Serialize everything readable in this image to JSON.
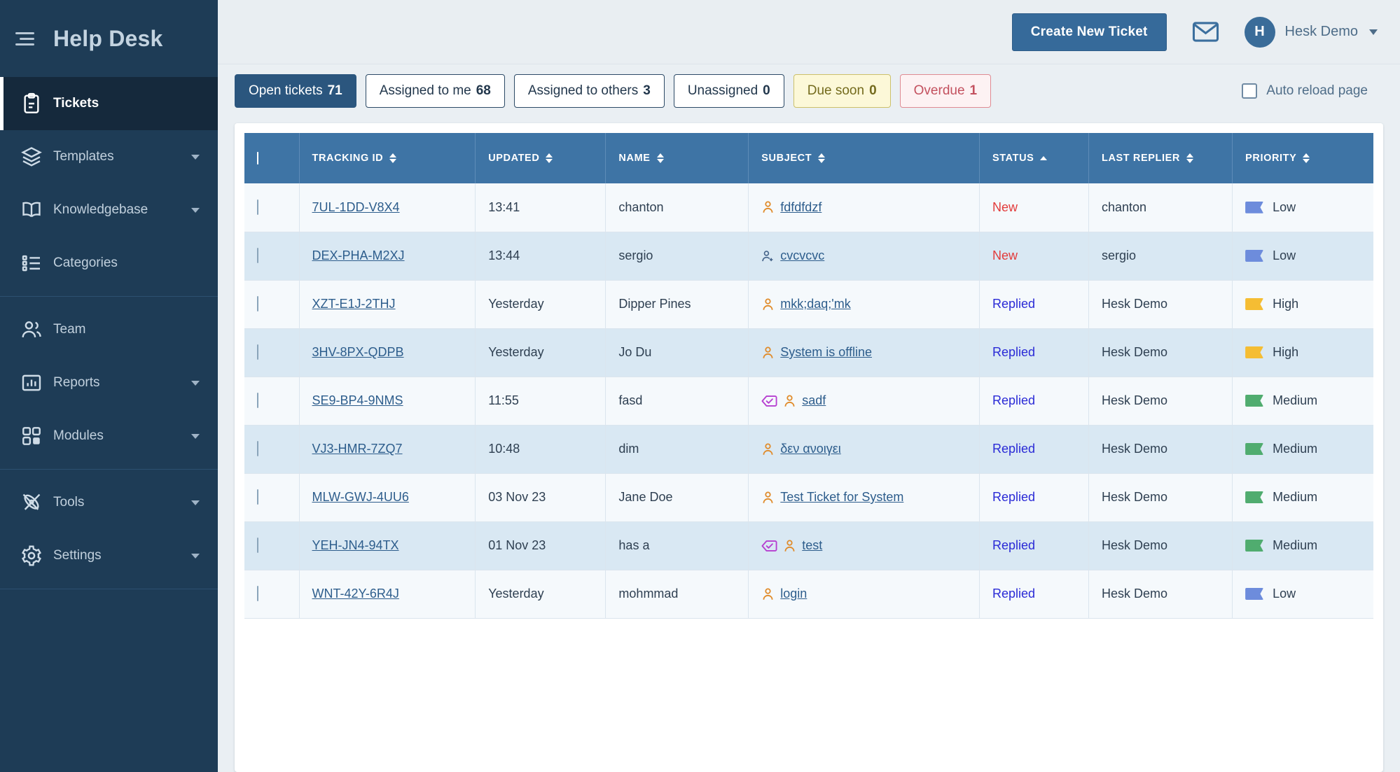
{
  "sidebar": {
    "brand": "Help Desk",
    "menu_icon": "hamburger-icon",
    "items": [
      {
        "label": "Tickets",
        "icon": "clipboard-icon",
        "active": true,
        "caret": false,
        "sep_after": false
      },
      {
        "label": "Templates",
        "icon": "layers-icon",
        "active": false,
        "caret": true,
        "sep_after": false
      },
      {
        "label": "Knowledgebase",
        "icon": "book-icon",
        "active": false,
        "caret": true,
        "sep_after": false
      },
      {
        "label": "Categories",
        "icon": "list-icon",
        "active": false,
        "caret": false,
        "sep_after": true
      },
      {
        "label": "Team",
        "icon": "users-icon",
        "active": false,
        "caret": false,
        "sep_after": false
      },
      {
        "label": "Reports",
        "icon": "bar-chart-icon",
        "active": false,
        "caret": true,
        "sep_after": false
      },
      {
        "label": "Modules",
        "icon": "grid-icon",
        "active": false,
        "caret": true,
        "sep_after": true
      },
      {
        "label": "Tools",
        "icon": "tools-icon",
        "active": false,
        "caret": true,
        "sep_after": false
      },
      {
        "label": "Settings",
        "icon": "gear-icon",
        "active": false,
        "caret": true,
        "sep_after": true
      }
    ]
  },
  "topbar": {
    "create_label": "Create New Ticket",
    "mail_icon": "envelope-icon",
    "avatar_initial": "H",
    "user_name": "Hesk Demo",
    "user_chevron": "chevron-down-icon"
  },
  "filters": {
    "chips": [
      {
        "label": "Open tickets",
        "count": "71",
        "style": "active"
      },
      {
        "label": "Assigned to me",
        "count": "68",
        "style": "plain"
      },
      {
        "label": "Assigned to others",
        "count": "3",
        "style": "plain"
      },
      {
        "label": "Unassigned",
        "count": "0",
        "style": "plain"
      },
      {
        "label": "Due soon",
        "count": "0",
        "style": "warn"
      },
      {
        "label": "Overdue",
        "count": "1",
        "style": "danger"
      }
    ],
    "auto_reload_label": "Auto reload page",
    "auto_reload_checked": false
  },
  "table": {
    "select_all_icon": "checkbox-icon",
    "columns": [
      {
        "key": "check",
        "label": "",
        "sortable": false,
        "sort": "none"
      },
      {
        "key": "tracking",
        "label": "TRACKING ID",
        "sortable": true,
        "sort": "none"
      },
      {
        "key": "updated",
        "label": "UPDATED",
        "sortable": true,
        "sort": "none"
      },
      {
        "key": "name",
        "label": "NAME",
        "sortable": true,
        "sort": "none"
      },
      {
        "key": "subject",
        "label": "SUBJECT",
        "sortable": true,
        "sort": "none"
      },
      {
        "key": "status",
        "label": "STATUS",
        "sortable": true,
        "sort": "asc"
      },
      {
        "key": "replier",
        "label": "LAST REPLIER",
        "sortable": true,
        "sort": "none"
      },
      {
        "key": "priority",
        "label": "PRIORITY",
        "sortable": true,
        "sort": "none"
      }
    ],
    "rows": [
      {
        "tracking": "7UL-1DD-V8X4",
        "updated": "13:41",
        "name": "chanton",
        "subject": "fdfdfdzf",
        "subject_icons": [
          "person-icon"
        ],
        "status": "New",
        "replier": "chanton",
        "priority": "Low",
        "priority_color": "#6d8cdc"
      },
      {
        "tracking": "DEX-PHA-M2XJ",
        "updated": "13:44",
        "name": "sergio",
        "subject": "cvcvcvc",
        "subject_icons": [
          "person-add-icon"
        ],
        "status": "New",
        "replier": "sergio",
        "priority": "Low",
        "priority_color": "#6d8cdc"
      },
      {
        "tracking": "XZT-E1J-2THJ",
        "updated": "Yesterday",
        "name": "Dipper Pines",
        "subject": "mkk;daq;'mk",
        "subject_icons": [
          "person-icon"
        ],
        "status": "Replied",
        "replier": "Hesk Demo",
        "priority": "High",
        "priority_color": "#f5bd33"
      },
      {
        "tracking": "3HV-8PX-QDPB",
        "updated": "Yesterday",
        "name": "Jo Du",
        "subject": "System is offline",
        "subject_icons": [
          "person-icon"
        ],
        "status": "Replied",
        "replier": "Hesk Demo",
        "priority": "High",
        "priority_color": "#f5bd33"
      },
      {
        "tracking": "SE9-BP4-9NMS",
        "updated": "11:55",
        "name": "fasd",
        "subject": "sadf",
        "subject_icons": [
          "tag-check-icon",
          "person-icon"
        ],
        "status": "Replied",
        "replier": "Hesk Demo",
        "priority": "Medium",
        "priority_color": "#50ac6f"
      },
      {
        "tracking": "VJ3-HMR-7ZQ7",
        "updated": "10:48",
        "name": "dim",
        "subject": "δεν ανοιγει",
        "subject_icons": [
          "person-icon"
        ],
        "status": "Replied",
        "replier": "Hesk Demo",
        "priority": "Medium",
        "priority_color": "#50ac6f"
      },
      {
        "tracking": "MLW-GWJ-4UU6",
        "updated": "03 Nov 23",
        "name": "Jane Doe",
        "subject": "Test Ticket for System",
        "subject_icons": [
          "person-icon"
        ],
        "status": "Replied",
        "replier": "Hesk Demo",
        "priority": "Medium",
        "priority_color": "#50ac6f"
      },
      {
        "tracking": "YEH-JN4-94TX",
        "updated": "01 Nov 23",
        "name": "has a",
        "subject": "test",
        "subject_icons": [
          "tag-check-icon",
          "person-icon"
        ],
        "status": "Replied",
        "replier": "Hesk Demo",
        "priority": "Medium",
        "priority_color": "#50ac6f"
      },
      {
        "tracking": "WNT-42Y-6R4J",
        "updated": "Yesterday",
        "name": "mohmmad",
        "subject": "login",
        "subject_icons": [
          "person-icon"
        ],
        "status": "Replied",
        "replier": "Hesk Demo",
        "priority": "Low",
        "priority_color": "#6d8cdc"
      }
    ]
  },
  "colors": {
    "sidebar_bg": "#1e3c56",
    "sidebar_active": "#15293c",
    "accent": "#366a9a",
    "table_header": "#3e74a5",
    "status_new": "#e23b3b",
    "status_replied": "#2a2ad6",
    "person_icon": "#e08b2a",
    "tag_icon": "#b63fd0"
  }
}
